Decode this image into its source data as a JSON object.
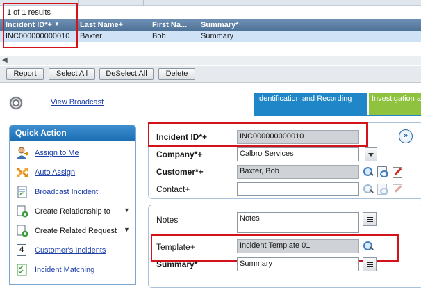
{
  "grid": {
    "results_text": "1 of 1 results",
    "columns": [
      "Incident ID*+",
      "Last Name+",
      "First Na...",
      "Summary*"
    ],
    "sort_indicator": "▼",
    "row": [
      "INC000000000010",
      "Baxter",
      "Bob",
      "Summary"
    ],
    "scroll_arrow": "◀"
  },
  "toolbar": {
    "report": "Report",
    "select_all": "Select All",
    "deselect_all": "DeSelect All",
    "delete": "Delete"
  },
  "view_broadcast": "View Broadcast",
  "stages": {
    "stage1": "Identification and Recording",
    "stage2": "Investigation and Diagnosis"
  },
  "expand_icon": "»",
  "quick_action": {
    "title": "Quick Action",
    "items": [
      {
        "label": "Assign to Me"
      },
      {
        "label": "Auto Assign"
      },
      {
        "label": "Broadcast Incident"
      },
      {
        "label": "Create Relationship to"
      },
      {
        "label": "Create Related Request"
      },
      {
        "label": "Customer's Incidents",
        "icon_text": "4"
      },
      {
        "label": "Incident Matching"
      }
    ]
  },
  "form": {
    "incident_id": {
      "label": "Incident ID*+",
      "value": "INC000000000010"
    },
    "company": {
      "label": "Company*+",
      "value": "Calbro Services"
    },
    "customer": {
      "label": "Customer*+",
      "value": "Baxter, Bob"
    },
    "contact": {
      "label": "Contact+",
      "value": ""
    },
    "notes": {
      "label": "Notes",
      "value": "Notes"
    },
    "template": {
      "label": "Template+",
      "value": "Incident Template 01"
    },
    "summary": {
      "label": "Summary*",
      "value": "Summary"
    }
  },
  "colors": {
    "highlight": "#d3121a",
    "stage_blue": "#1f86c8",
    "stage_green": "#8fc23f",
    "header_blue": "#4f7297"
  }
}
